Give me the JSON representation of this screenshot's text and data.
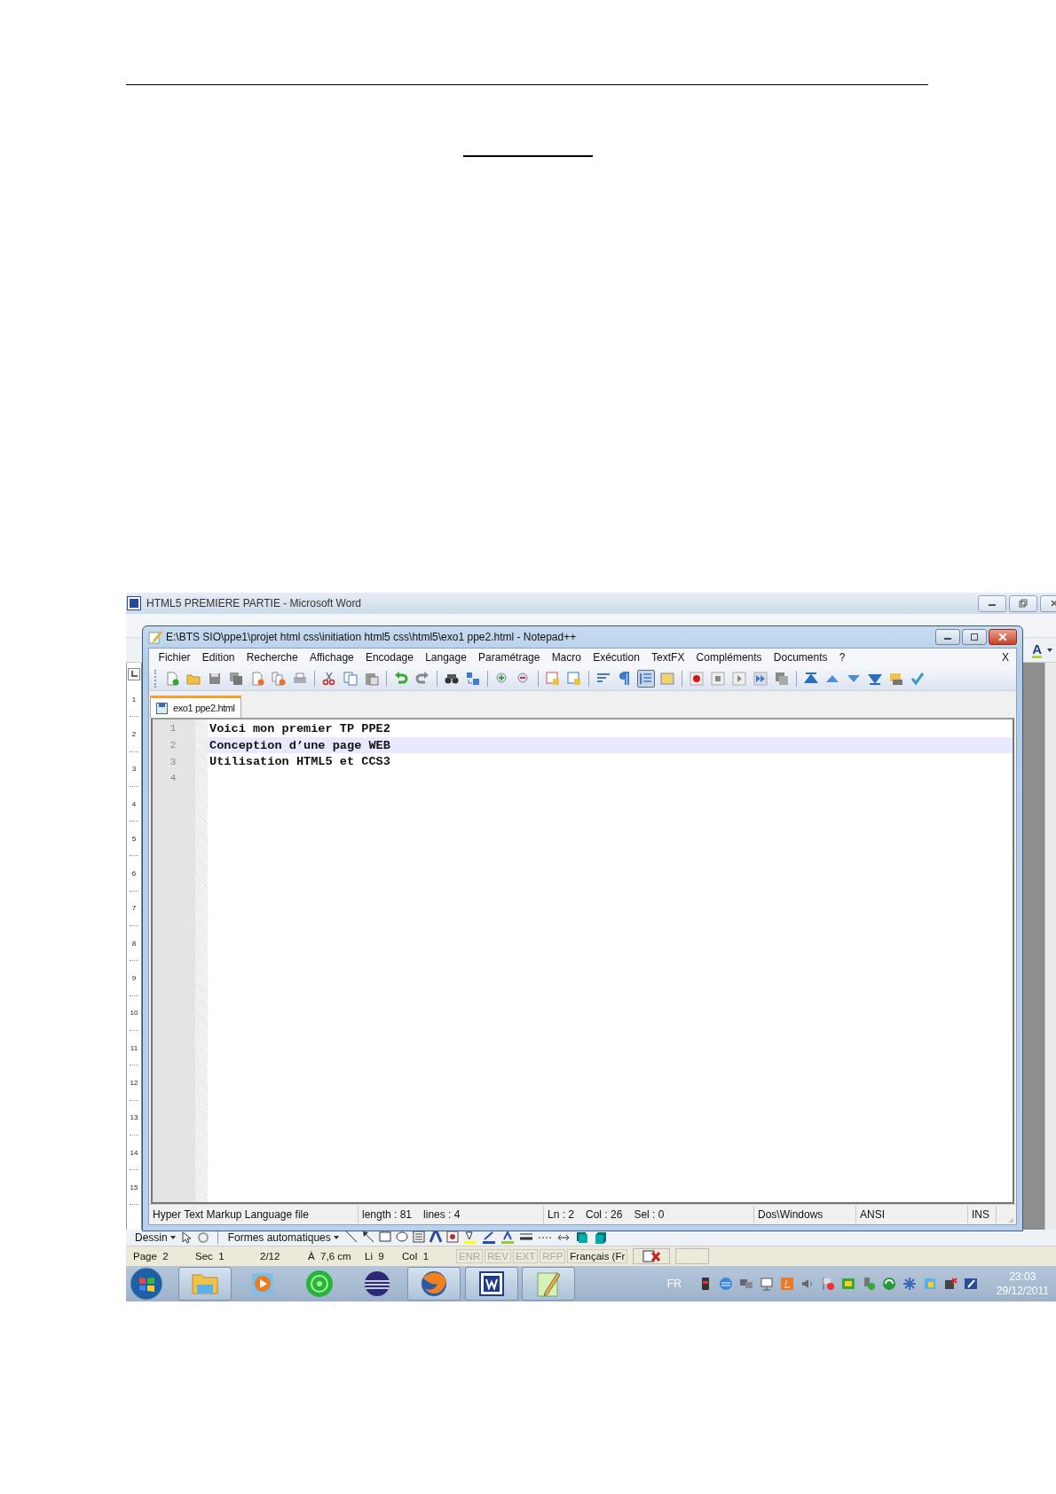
{
  "word": {
    "title": "HTML5 PREMIERE PARTIE - Microsoft Word",
    "font_color_label": "A",
    "ruler": [
      "1",
      "2",
      "3",
      "4",
      "5",
      "6",
      "7",
      "8",
      "9",
      "10",
      "11",
      "12",
      "13",
      "14",
      "15"
    ],
    "drawing_toolbar": [
      "Dessin",
      "Formes automatiques"
    ],
    "status_bar": [
      {
        "text": "Page  2",
        "disabled": false
      },
      {
        "text": "Sec  1",
        "disabled": false
      },
      {
        "text": "2/12",
        "disabled": false
      },
      {
        "text": "À  7,6 cm",
        "disabled": false
      },
      {
        "text": "Li  9",
        "disabled": false
      },
      {
        "text": "Col  1",
        "disabled": false
      },
      {
        "text": "ENR",
        "disabled": true
      },
      {
        "text": "REV",
        "disabled": true
      },
      {
        "text": "EXT",
        "disabled": true
      },
      {
        "text": "RFP",
        "disabled": true
      },
      {
        "text": "Français (Fr",
        "disabled": false
      }
    ]
  },
  "notepad": {
    "title": "E:\\BTS SIO\\ppe1\\projet html css\\initiation html5 css\\html5\\exo1 ppe2.html - Notepad++",
    "menu": [
      "Fichier",
      "Edition",
      "Recherche",
      "Affichage",
      "Encodage",
      "Langage",
      "Paramétrage",
      "Macro",
      "Exécution",
      "TextFX",
      "Compléments",
      "Documents",
      "?"
    ],
    "menu_close": "X",
    "toolbar": [
      {
        "pressed": false
      },
      {
        "pressed": false
      },
      {
        "pressed": false
      },
      {
        "pressed": false
      },
      {
        "pressed": false
      },
      {
        "pressed": false
      },
      {
        "pressed": false
      },
      {
        "pressed": false
      },
      {
        "pressed": false
      },
      {
        "pressed": false
      },
      {
        "pressed": false
      },
      {
        "pressed": false
      },
      {
        "pressed": false
      },
      {
        "pressed": false
      },
      {
        "pressed": false
      },
      {
        "pressed": false
      },
      {
        "pressed": false
      },
      {
        "pressed": false
      },
      {
        "pressed": false
      },
      {
        "pressed": false
      },
      {
        "pressed": true
      },
      {
        "pressed": false
      },
      {
        "pressed": false
      },
      {
        "pressed": false
      },
      {
        "pressed": false
      },
      {
        "pressed": false
      },
      {
        "pressed": false
      },
      {
        "pressed": false
      },
      {
        "pressed": false
      },
      {
        "pressed": false
      },
      {
        "pressed": false
      },
      {
        "pressed": false
      },
      {
        "pressed": false
      }
    ],
    "tabs": [
      {
        "label": "exo1 ppe2.html",
        "selected": true
      }
    ],
    "lines": [
      {
        "number": "1",
        "text": "Voici mon premier TP PPE2",
        "current": false
      },
      {
        "number": "2",
        "text": "Conception d’une page WEB",
        "current": true
      },
      {
        "number": "3",
        "text": "Utilisation HTML5 et CCS3",
        "current": false
      },
      {
        "number": "4",
        "current": false
      }
    ],
    "status_bar": {
      "file_type": "Hyper Text Markup Language file",
      "length": "length : 81",
      "lines": "lines : 4",
      "line": "Ln : 2",
      "column": "Col : 26",
      "selection": "Sel : 0",
      "eol": "Dos\\Windows",
      "encoding": "ANSI",
      "mode": "INS"
    }
  },
  "taskbar": {
    "apps": [
      {
        "kind": "folder",
        "running": true
      },
      {
        "kind": "media",
        "running": false
      },
      {
        "kind": "disc",
        "running": false
      },
      {
        "kind": "sphere",
        "running": false
      },
      {
        "kind": "browser",
        "running": true
      },
      {
        "kind": "word",
        "running": true
      },
      {
        "kind": "notepad",
        "running": true
      }
    ],
    "language": "FR",
    "time": "23:03",
    "date": "29/12/2011"
  }
}
